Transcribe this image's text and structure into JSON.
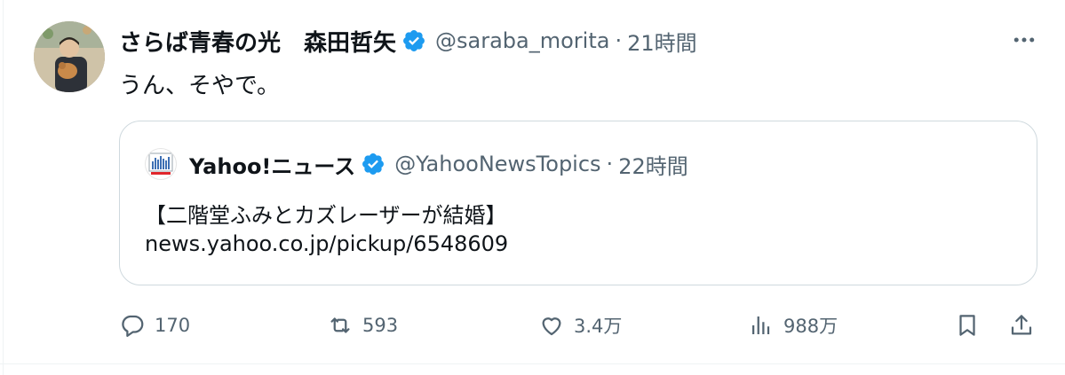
{
  "tweet": {
    "author": {
      "display_name": "さらば青春の光　森田哲矢",
      "handle": "@saraba_morita",
      "verified_icon": "verified-badge-icon"
    },
    "separator": "·",
    "time": "21時間",
    "text": "うん、そやで。"
  },
  "quote": {
    "author": {
      "display_name": "Yahoo!ニュース",
      "handle": "@YahooNewsTopics",
      "verified_icon": "verified-badge-icon"
    },
    "separator": "·",
    "time": "22時間",
    "line1": "【二階堂ふみとカズレーザーが結婚】",
    "line2": "news.yahoo.co.jp/pickup/6548609"
  },
  "actions": {
    "replies": "170",
    "retweets": "593",
    "likes": "3.4万",
    "views": "988万"
  },
  "colors": {
    "text": "#0f1419",
    "secondary": "#536471",
    "verified": "#1d9bf0",
    "border": "#cfd9de"
  }
}
